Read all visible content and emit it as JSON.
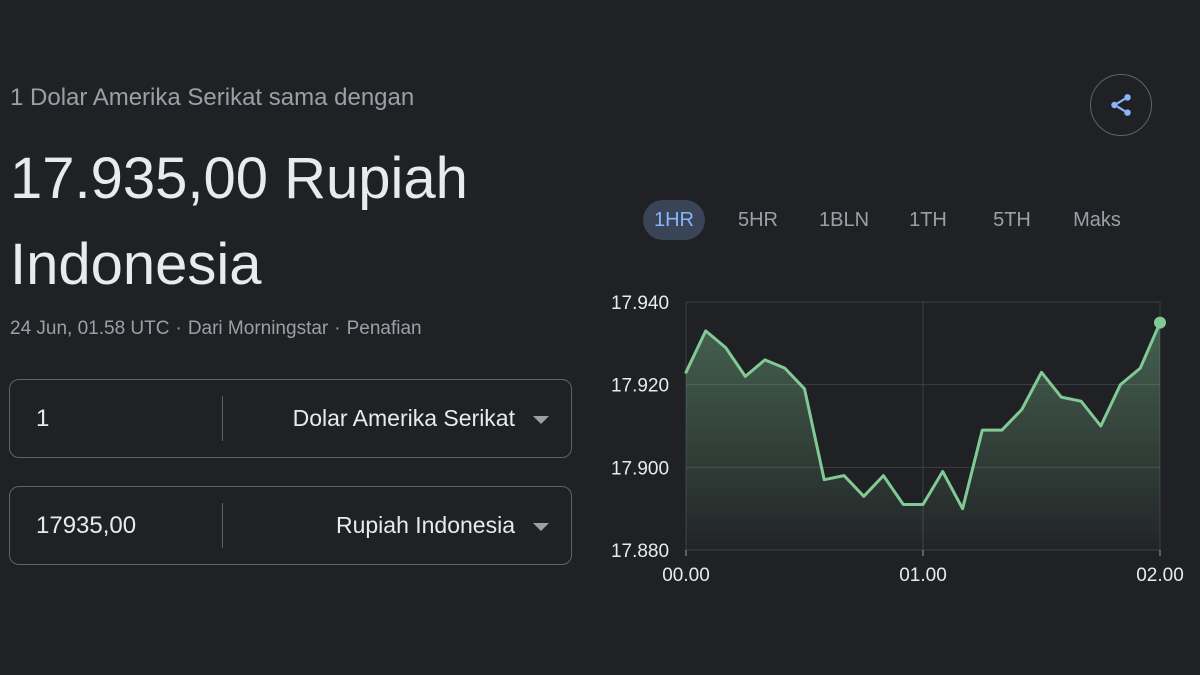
{
  "header": {
    "subtitle": "1 Dolar Amerika Serikat sama dengan",
    "rate_line1": "17.935,00 Rupiah",
    "rate_line2": "Indonesia"
  },
  "meta": {
    "timestamp": "24 Jun, 01.58 UTC",
    "source": "Dari Morningstar",
    "disclaimer": "Penafian",
    "separator": "·"
  },
  "converter": {
    "from": {
      "amount": "1",
      "currency": "Dolar Amerika Serikat"
    },
    "to": {
      "amount": "17935,00",
      "currency": "Rupiah Indonesia"
    }
  },
  "tabs": [
    {
      "label": "1HR",
      "active": true
    },
    {
      "label": "5HR",
      "active": false
    },
    {
      "label": "1BLN",
      "active": false
    },
    {
      "label": "1TH",
      "active": false
    },
    {
      "label": "5TH",
      "active": false
    },
    {
      "label": "Maks",
      "active": false
    }
  ],
  "icons": {
    "share": "share-icon",
    "dropdown": "chevron-down-icon"
  },
  "colors": {
    "background": "#202124",
    "line": "#81c995",
    "active_tab_bg": "#394457",
    "active_tab_text": "#8ab4f8",
    "grid": "#3c4043",
    "muted_text": "#9aa0a6"
  },
  "chart_data": {
    "type": "area",
    "x_ticks": [
      "00.00",
      "01.00",
      "02.00"
    ],
    "y_ticks": [
      "17.940",
      "17.920",
      "17.900",
      "17.880"
    ],
    "y_tick_values": [
      17940,
      17920,
      17900,
      17880
    ],
    "ylim": [
      17880,
      17940
    ],
    "xlim": [
      0,
      2
    ],
    "grid": true,
    "series": [
      {
        "x": [
          0,
          0.083,
          0.167,
          0.25,
          0.333,
          0.417,
          0.5,
          0.583,
          0.667,
          0.75,
          0.833,
          0.917,
          1.0,
          1.083,
          1.167,
          1.25,
          1.333,
          1.417,
          1.5,
          1.583,
          1.667,
          1.75,
          1.833,
          1.917,
          2.0
        ],
        "values": [
          17923,
          17933,
          17929,
          17922,
          17926,
          17924,
          17919,
          17897,
          17898,
          17893,
          17898,
          17891,
          17891,
          17899,
          17890,
          17909,
          17909,
          17914,
          17923,
          17917,
          17916,
          17910,
          17920,
          17924,
          17935
        ]
      }
    ]
  }
}
